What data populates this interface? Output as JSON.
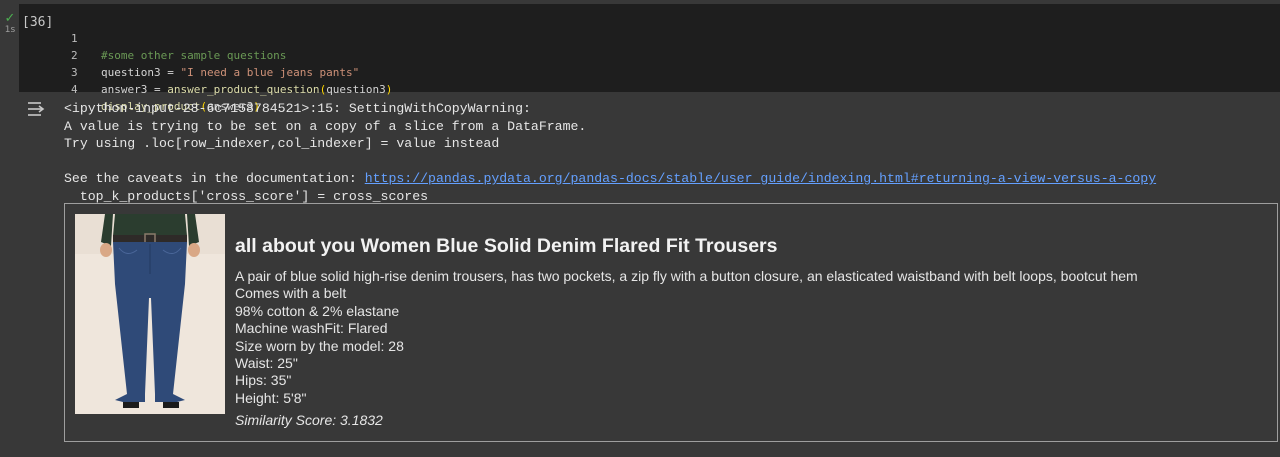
{
  "cell": {
    "run_time": "1s",
    "exec_count": "[36]",
    "code": {
      "line_numbers": [
        "1",
        "2",
        "3",
        "4"
      ],
      "line1_comment": "#some other sample questions",
      "line2_var": "question3 = ",
      "line2_str": "\"I need a blue jeans pants\"",
      "line3_var": "answer3 = ",
      "line3_fn": "answer_product_question",
      "line3_open": "(",
      "line3_arg": "question3",
      "line3_close": ")",
      "line4_fn": "display_product",
      "line4_open": "(",
      "line4_arg": "answer3",
      "line4_close": ")"
    }
  },
  "output": {
    "warning_lines": [
      "<ipython-input-28-6c7158784521>:15: SettingWithCopyWarning:",
      "A value is trying to be set on a copy of a slice from a DataFrame.",
      "Try using .loc[row_indexer,col_indexer] = value instead",
      "",
      "See the caveats in the documentation: ",
      "  top_k_products['cross_score'] = cross_scores"
    ],
    "doc_link": "https://pandas.pydata.org/pandas-docs/stable/user_guide/indexing.html#returning-a-view-versus-a-copy"
  },
  "product": {
    "title": "all about you Women Blue Solid Denim Flared Fit Trousers",
    "description_lines": [
      "A pair of blue solid high-rise denim trousers, has two pockets, a zip fly with a button closure, an elasticated waistband with belt loops, bootcut hem",
      "Comes with a belt",
      "98% cotton & 2% elastane",
      "Machine washFit: Flared",
      "Size worn by the model: 28",
      "Waist: 25\"",
      "Hips: 35\"",
      "Height: 5'8\""
    ],
    "similarity": "Similarity Score: 3.1832"
  },
  "colors": {
    "background": "#383838",
    "code_background": "#1e1e1e",
    "link": "#64a0ff",
    "check": "#4caf50"
  }
}
